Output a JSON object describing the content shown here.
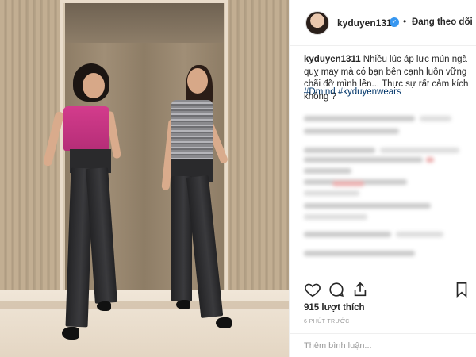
{
  "post": {
    "username": "kyduyen1311",
    "verified_icon": "verified-badge-icon",
    "separator": "•",
    "follow_status": "Đang theo dõi",
    "caption_user": "kyduyen1311",
    "caption_text": " Nhiều lúc áp lực mún ngã quỵ may mà có bạn bên cạnh luôn vững chãi đỡ mình lên... Thực sự rất cảm kích không ?",
    "hashtags": "#Dmind #kyduyenwears",
    "likes": "915 lượt thích",
    "time_ago": "6 PHÚT TRƯỚC",
    "comment_placeholder": "Thêm bình luận..."
  },
  "icons": {
    "like": "heart-icon",
    "comment": "comment-bubble-icon",
    "share": "share-icon",
    "save": "bookmark-icon"
  },
  "colors": {
    "verified": "#3897f0",
    "hashtag": "#003569",
    "text": "#262626",
    "muted": "#999999"
  }
}
